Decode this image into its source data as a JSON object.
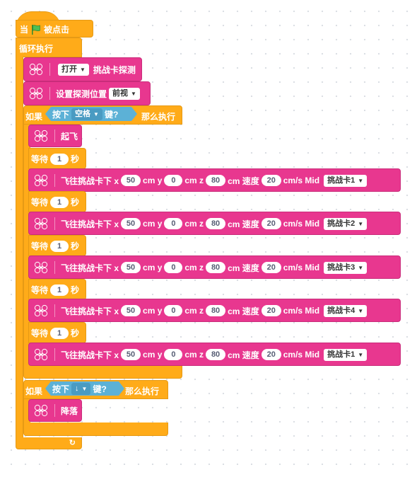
{
  "hat": {
    "when": "当",
    "flag_icon": "green-flag-icon",
    "clicked": "被点击"
  },
  "loop": {
    "label": "循环执行",
    "arrow": "↻"
  },
  "open_block": {
    "option": "打开",
    "label": "挑战卡探测"
  },
  "position_block": {
    "label": "设置探测位置",
    "option": "前视"
  },
  "if1": {
    "if": "如果",
    "press": "按下",
    "key": "空格",
    "key_suffix": "键?",
    "then": "那么执行"
  },
  "takeoff": {
    "label": "起飞"
  },
  "wait": {
    "label": "等待",
    "unit": "秒"
  },
  "fly": {
    "label": "飞往挑战卡下 x",
    "cm_y": "cm y",
    "cm_z": "cm z",
    "cm_speed": "cm 速度",
    "cms_mid": "cm/s Mid"
  },
  "fly_blocks": [
    {
      "x": "50",
      "y": "0",
      "z": "80",
      "speed": "20",
      "card": "挑战卡1"
    },
    {
      "x": "50",
      "y": "0",
      "z": "80",
      "speed": "20",
      "card": "挑战卡2"
    },
    {
      "x": "50",
      "y": "0",
      "z": "80",
      "speed": "20",
      "card": "挑战卡3"
    },
    {
      "x": "50",
      "y": "0",
      "z": "80",
      "speed": "20",
      "card": "挑战卡4"
    },
    {
      "x": "50",
      "y": "0",
      "z": "80",
      "speed": "20",
      "card": "挑战卡1"
    }
  ],
  "waits": [
    "1",
    "1",
    "1",
    "1",
    "1"
  ],
  "if2": {
    "if": "如果",
    "press": "按下",
    "key": "↓",
    "key_suffix": "键?",
    "then": "那么执行"
  },
  "land": {
    "label": "降落"
  },
  "colors": {
    "events": "#FFAB19",
    "drone": "#E8378F",
    "sensing": "#5CB1D6"
  }
}
